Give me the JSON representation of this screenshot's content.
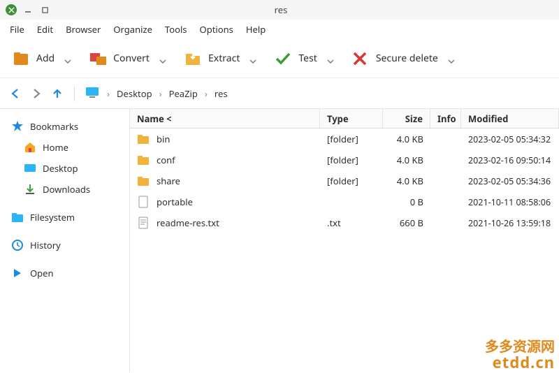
{
  "window": {
    "title": "res"
  },
  "menu": [
    "File",
    "Edit",
    "Browser",
    "Organize",
    "Tools",
    "Options",
    "Help"
  ],
  "toolbar": [
    {
      "id": "add",
      "label": "Add"
    },
    {
      "id": "convert",
      "label": "Convert"
    },
    {
      "id": "extract",
      "label": "Extract"
    },
    {
      "id": "test",
      "label": "Test"
    },
    {
      "id": "secure-delete",
      "label": "Secure delete"
    }
  ],
  "breadcrumb": [
    "Desktop",
    "PeaZip",
    "res"
  ],
  "sidebar": {
    "bookmarks": {
      "label": "Bookmarks",
      "items": [
        {
          "id": "home",
          "label": "Home"
        },
        {
          "id": "desktop",
          "label": "Desktop"
        },
        {
          "id": "downloads",
          "label": "Downloads"
        }
      ]
    },
    "filesystem": {
      "label": "Filesystem"
    },
    "history": {
      "label": "History"
    },
    "open": {
      "label": "Open"
    }
  },
  "columns": {
    "name": "Name <",
    "type": "Type",
    "size": "Size",
    "info": "Info",
    "modified": "Modified"
  },
  "files": [
    {
      "name": "bin",
      "type": "[folder]",
      "size": "4.0 KB",
      "info": "",
      "modified": "2023-02-05 05:34:32",
      "icon": "folder"
    },
    {
      "name": "conf",
      "type": "[folder]",
      "size": "4.0 KB",
      "info": "",
      "modified": "2023-02-16 09:50:14",
      "icon": "folder"
    },
    {
      "name": "share",
      "type": "[folder]",
      "size": "4.0 KB",
      "info": "",
      "modified": "2023-02-05 05:34:36",
      "icon": "folder"
    },
    {
      "name": "portable",
      "type": "",
      "size": "0 B",
      "info": "",
      "modified": "2021-10-11 08:58:06",
      "icon": "file"
    },
    {
      "name": "readme-res.txt",
      "type": ".txt",
      "size": "660 B",
      "info": "",
      "modified": "2021-10-26 13:59:18",
      "icon": "file-text"
    }
  ],
  "watermark": {
    "line1": "多多资源网",
    "line2": "etdd.cn"
  }
}
